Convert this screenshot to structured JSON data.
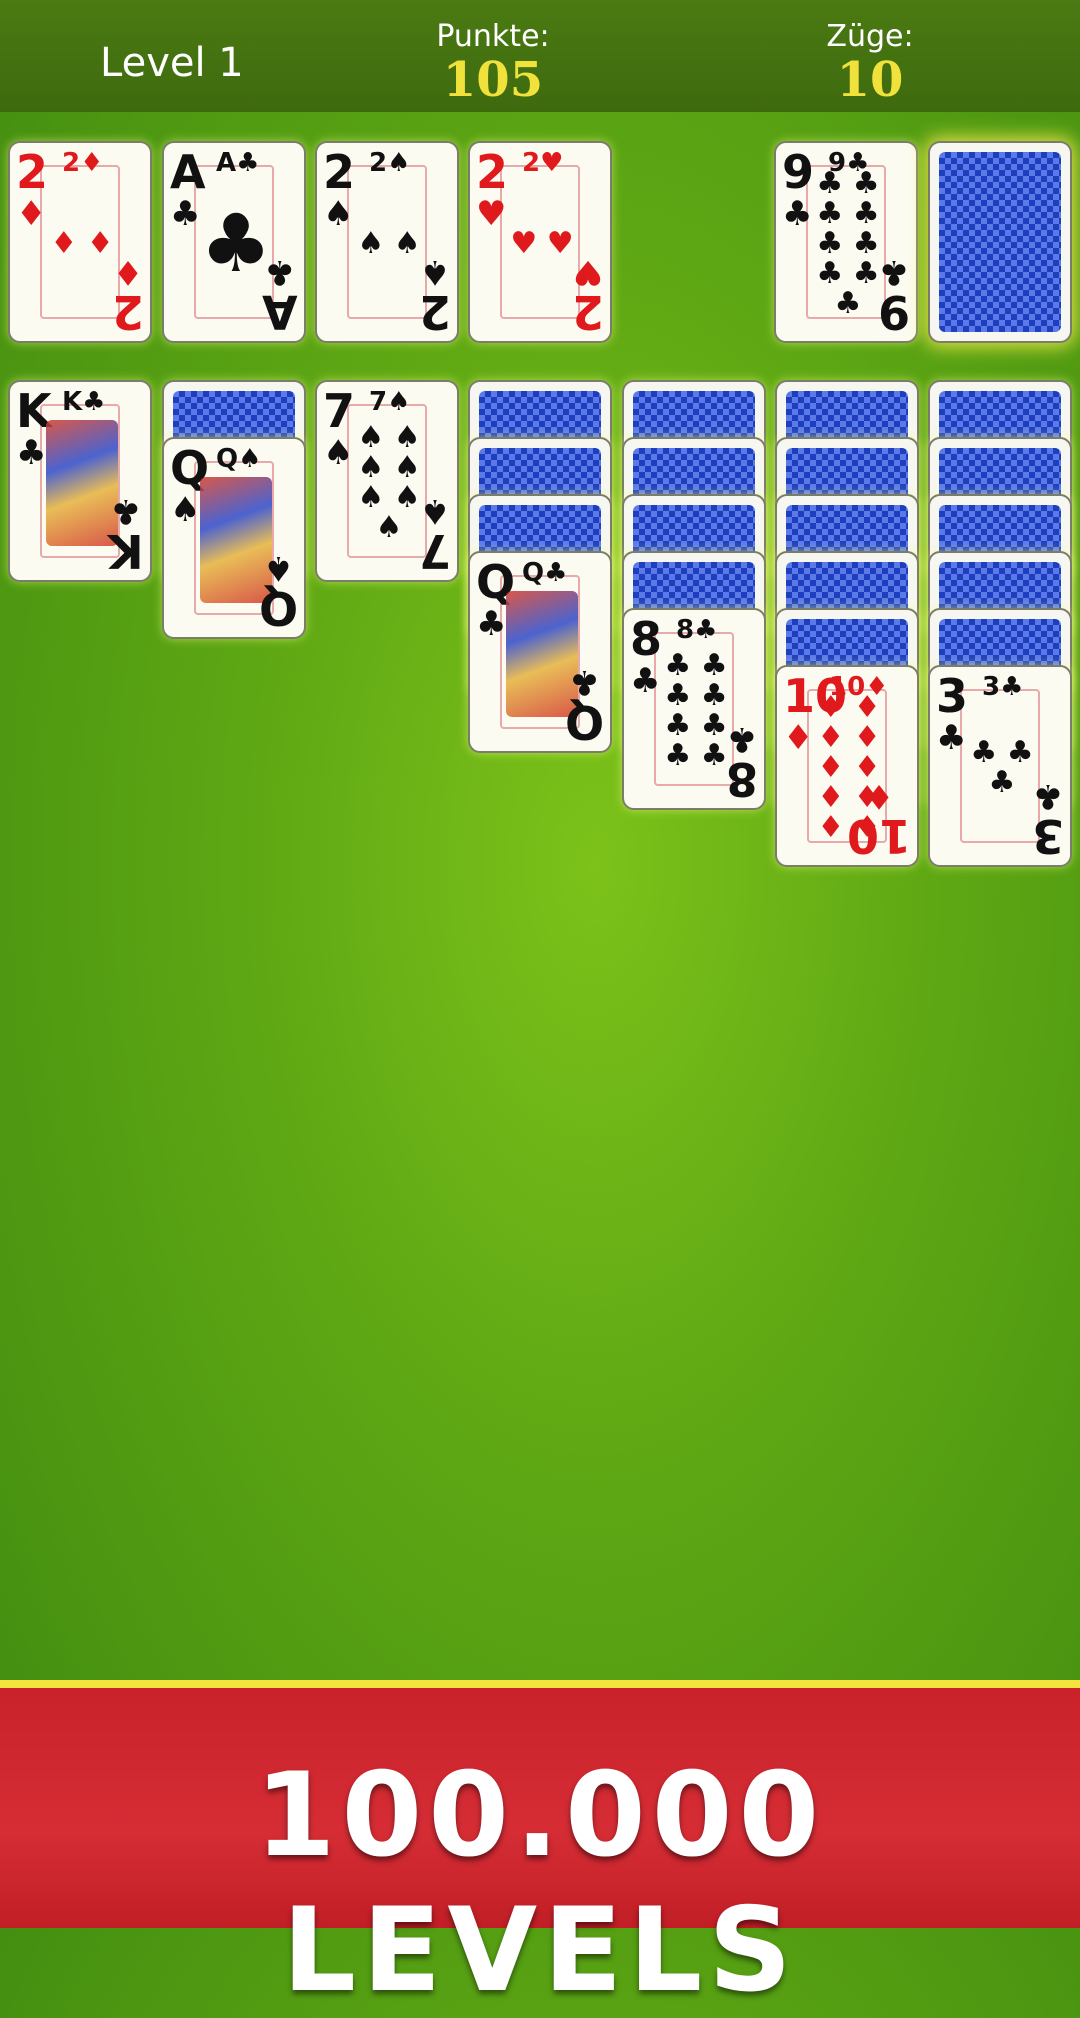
{
  "header": {
    "level": "Level 1",
    "points_label": "Punkte:",
    "points_value": "105",
    "moves_label": "Züge:",
    "moves_value": "10"
  },
  "foundations": [
    {
      "rank": "2",
      "suit": "♦",
      "color": "red"
    },
    {
      "rank": "A",
      "suit": "♣",
      "color": "black"
    },
    {
      "rank": "2",
      "suit": "♠",
      "color": "black"
    },
    {
      "rank": "2",
      "suit": "♥",
      "color": "red"
    }
  ],
  "waste": {
    "rank": "9",
    "suit": "♣",
    "color": "black"
  },
  "stock": {
    "icon": "card-back"
  },
  "tableau": [
    {
      "hidden": 0,
      "face": {
        "rank": "K",
        "suit": "♣",
        "color": "black"
      }
    },
    {
      "hidden": 1,
      "face": {
        "rank": "Q",
        "suit": "♠",
        "color": "black"
      }
    },
    {
      "hidden": 0,
      "face": {
        "rank": "7",
        "suit": "♠",
        "color": "black"
      }
    },
    {
      "hidden": 3,
      "face": {
        "rank": "Q",
        "suit": "♣",
        "color": "black"
      }
    },
    {
      "hidden": 4,
      "face": {
        "rank": "8",
        "suit": "♣",
        "color": "black"
      }
    },
    {
      "hidden": 5,
      "face": {
        "rank": "10",
        "suit": "♦",
        "color": "red"
      }
    },
    {
      "hidden": 5,
      "face": {
        "rank": "3",
        "suit": "♣",
        "color": "black"
      }
    }
  ],
  "banner": {
    "text": "100.000 LEVELS"
  },
  "colors": {
    "felt": "#5fa814",
    "topbar": "#3e6a0e",
    "score": "#f1e23b",
    "banner": "#d62d35",
    "banner_border": "#f3e53d",
    "card_back": "#1c3fbf"
  }
}
